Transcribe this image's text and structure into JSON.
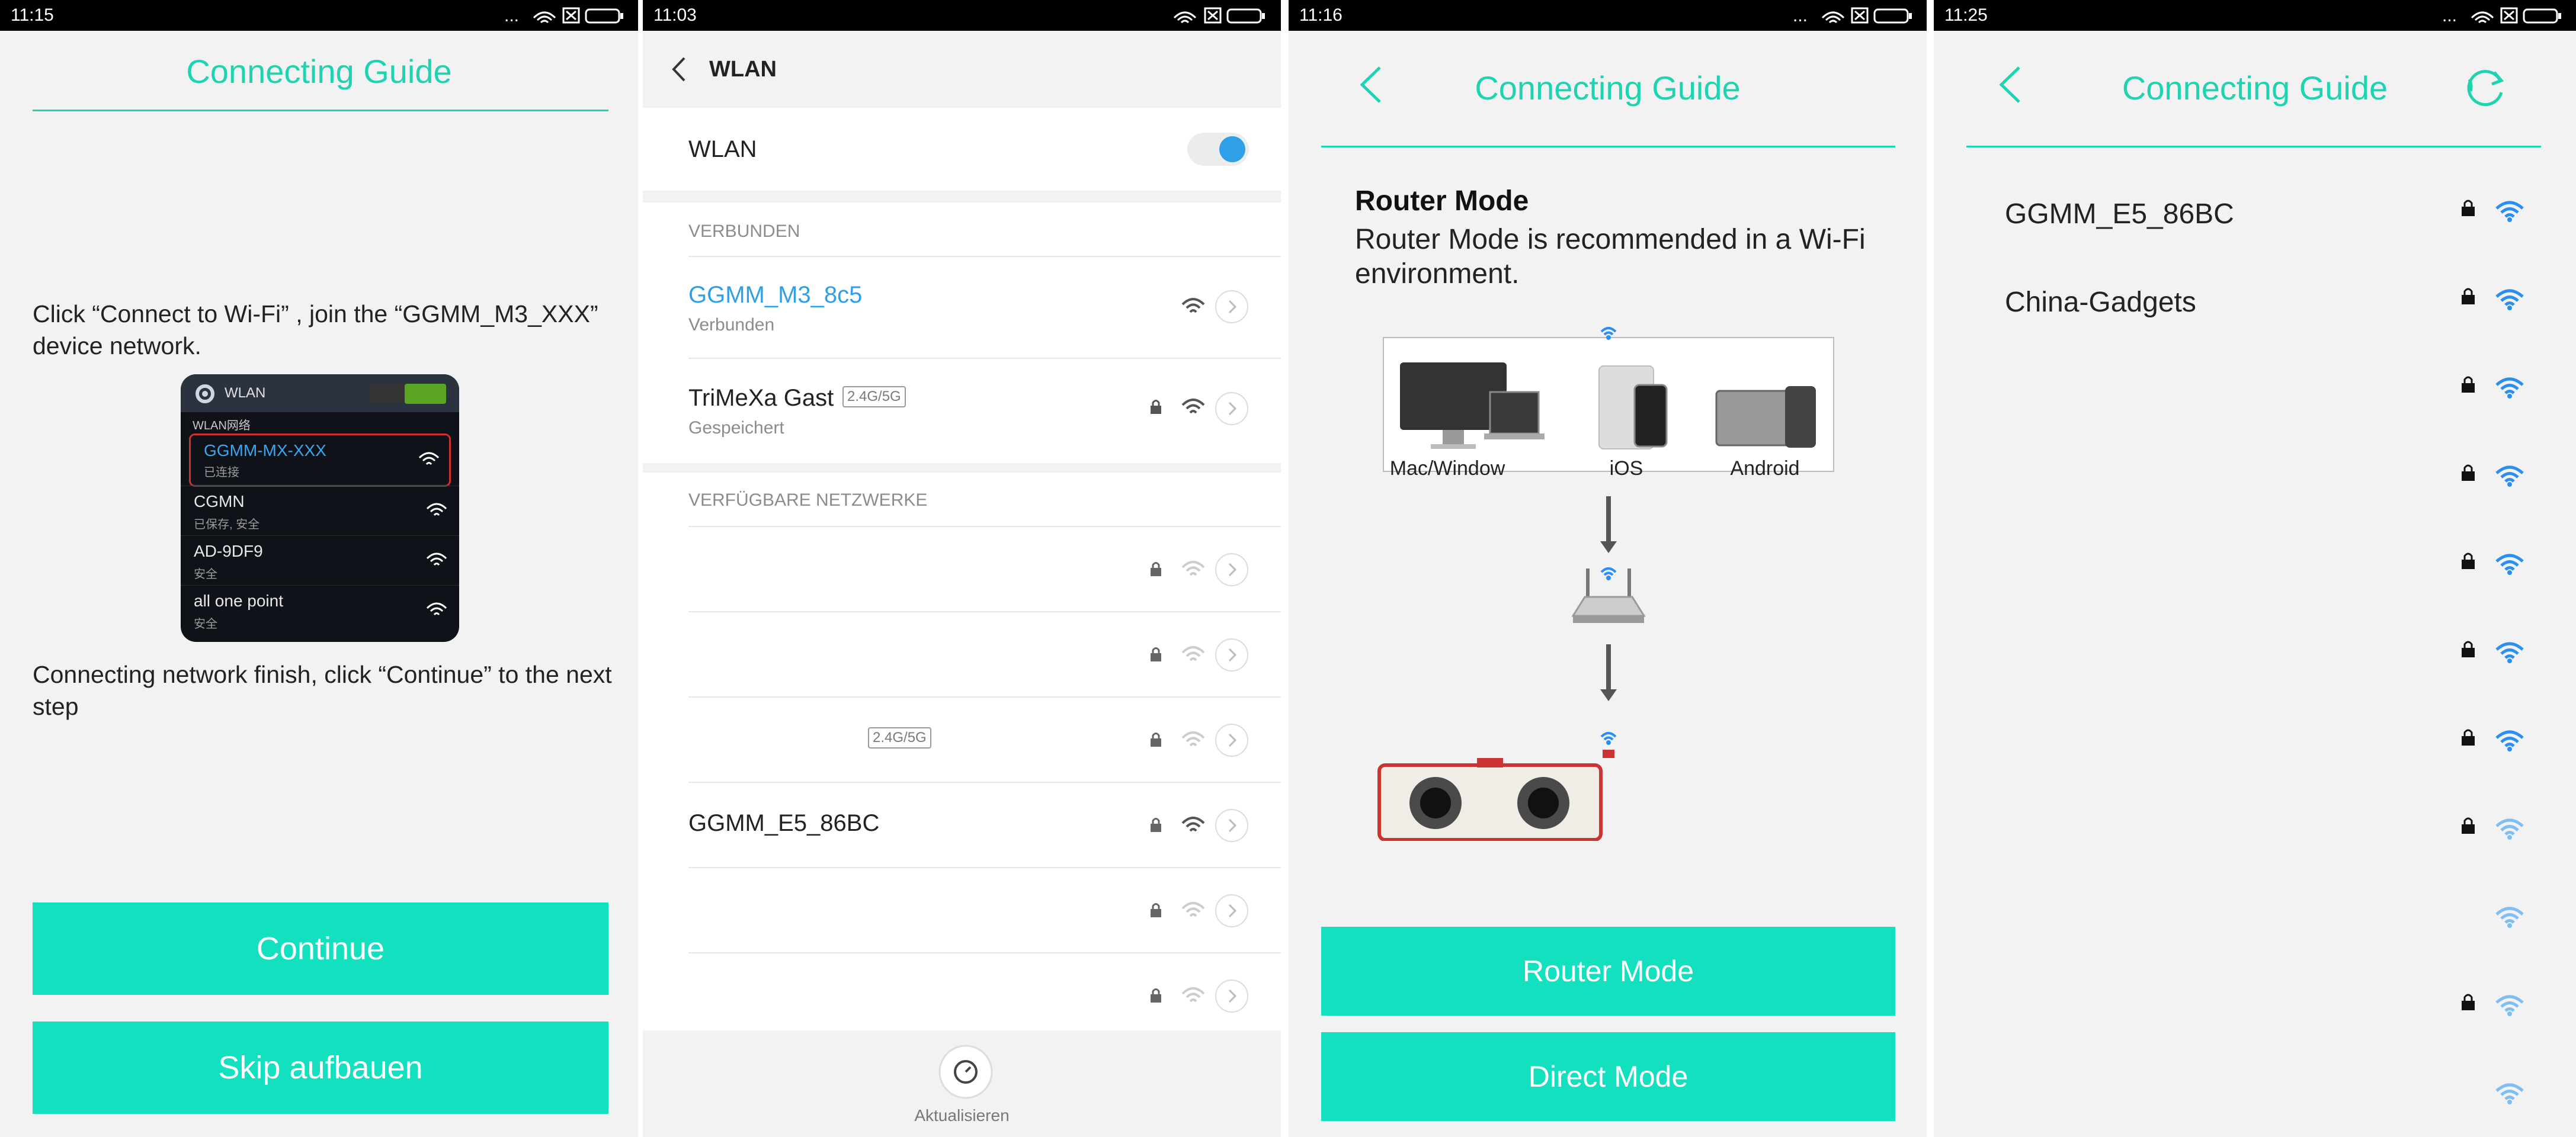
{
  "panel1": {
    "status_time": "11:15",
    "title": "Connecting Guide",
    "instruction1": "Click “Connect to Wi-Fi” , join the “GGMM_M3_XXX” device network.",
    "phone": {
      "title": "WLAN",
      "section": "WLAN网络",
      "networks": [
        {
          "name": "GGMM-MX-XXX",
          "sub": "已连接"
        },
        {
          "name": "CGMN",
          "sub": "已保存, 安全"
        },
        {
          "name": "AD-9DF9",
          "sub": "安全"
        },
        {
          "name": "all one point",
          "sub": "安全"
        }
      ]
    },
    "instruction2": "Connecting network finish, click “Continue” to the next step",
    "continue_label": "Continue",
    "skip_label": "Skip aufbauen"
  },
  "panel2": {
    "status_time": "11:03",
    "header_title": "WLAN",
    "wlan_label": "WLAN",
    "connected_section": "VERBUNDEN",
    "connected_name": "GGMM_M3_8c5",
    "connected_status": "Verbunden",
    "saved_name": "TriMeXa Gast",
    "saved_badge": "2.4G/5G",
    "saved_status": "Gespeichert",
    "available_section": "VERFÜGBARE NETZWERKE",
    "available": [
      {
        "name": "",
        "badge": ""
      },
      {
        "name": "",
        "badge": ""
      },
      {
        "name": "",
        "badge": "2.4G/5G"
      },
      {
        "name": "GGMM_E5_86BC",
        "badge": ""
      },
      {
        "name": "",
        "badge": ""
      },
      {
        "name": "",
        "badge": ""
      }
    ],
    "refresh_label": "Aktualisieren"
  },
  "panel3": {
    "status_time": "11:16",
    "title": "Connecting Guide",
    "mode_heading": "Router Mode",
    "mode_desc": "Router Mode is recommended in a Wi-Fi environment.",
    "devices": [
      "Mac/Window",
      "iOS",
      "Android"
    ],
    "router_btn": "Router Mode",
    "direct_btn": "Direct Mode"
  },
  "panel4": {
    "status_time": "11:25",
    "title": "Connecting Guide",
    "networks": [
      {
        "name": "GGMM_E5_86BC",
        "locked": true
      },
      {
        "name": "China-Gadgets",
        "locked": true
      },
      {
        "name": "",
        "locked": true
      },
      {
        "name": "",
        "locked": true
      },
      {
        "name": "",
        "locked": true
      },
      {
        "name": "",
        "locked": true
      },
      {
        "name": "",
        "locked": true
      },
      {
        "name": "",
        "locked": true
      },
      {
        "name": "",
        "locked": false
      },
      {
        "name": "",
        "locked": true
      },
      {
        "name": "",
        "locked": false
      }
    ]
  },
  "colors": {
    "accent": "#1dd3b0",
    "button": "#13e0be",
    "link_blue": "#2f9fe8",
    "wifi_blue": "#2a8ff0"
  }
}
